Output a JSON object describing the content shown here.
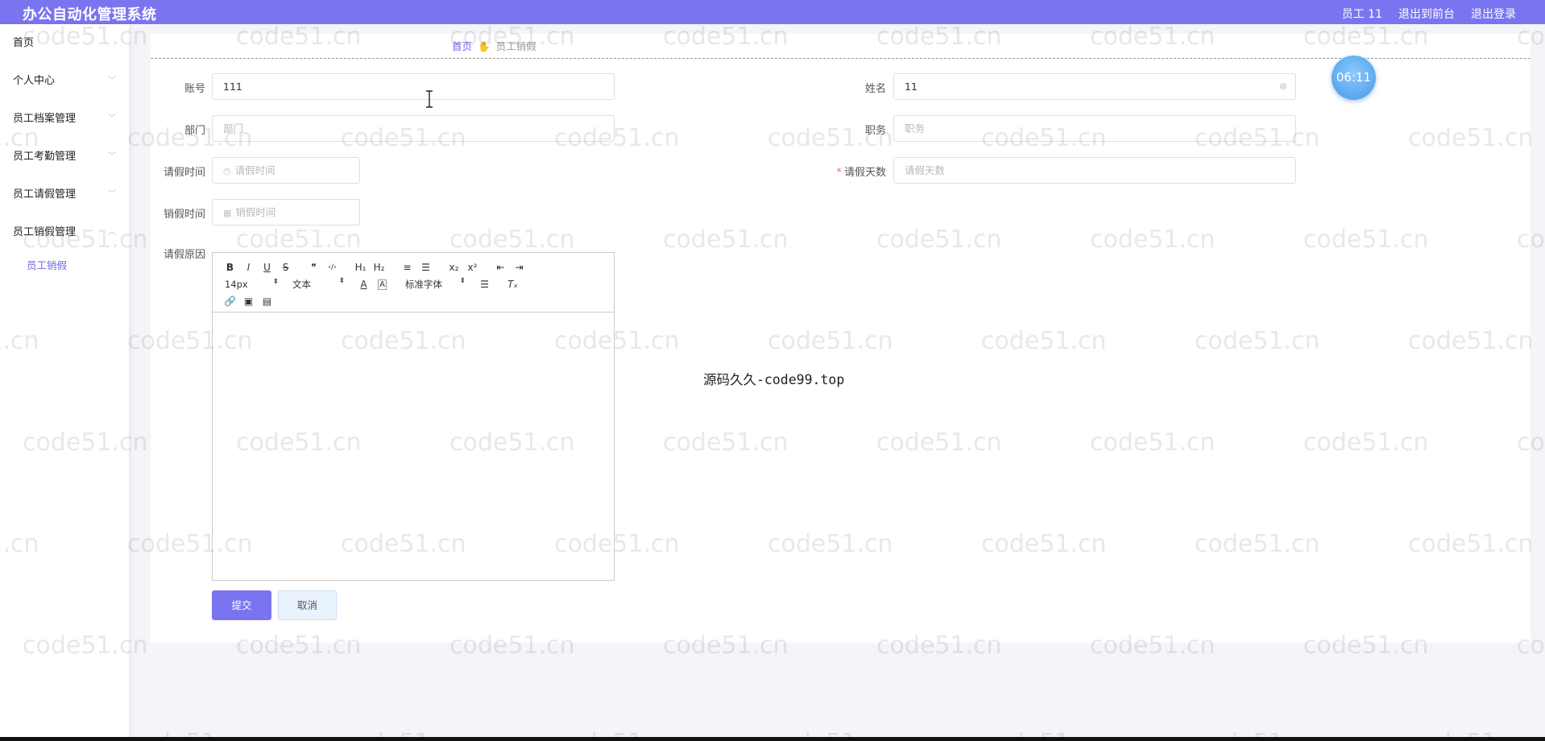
{
  "app": {
    "title": "办公自动化管理系统"
  },
  "header": {
    "user_label": "员工 11",
    "front_link": "退出到前台",
    "logout_link": "退出登录"
  },
  "sidebar": {
    "items": [
      {
        "label": "首页",
        "has_chevron": false
      },
      {
        "label": "个人中心",
        "has_chevron": true
      },
      {
        "label": "员工档案管理",
        "has_chevron": true
      },
      {
        "label": "员工考勤管理",
        "has_chevron": true
      },
      {
        "label": "员工请假管理",
        "has_chevron": true
      },
      {
        "label": "员工销假管理",
        "has_chevron": true
      }
    ],
    "active_subitem": "员工销假"
  },
  "breadcrumb": {
    "home": "首页",
    "current": "员工销假"
  },
  "form": {
    "account": {
      "label": "账号",
      "value": "111"
    },
    "name": {
      "label": "姓名",
      "value": "11"
    },
    "department": {
      "label": "部门",
      "placeholder": "部门"
    },
    "position": {
      "label": "职务",
      "placeholder": "职务"
    },
    "leave_time": {
      "label": "请假时间",
      "placeholder": "请假时间"
    },
    "leave_days": {
      "label": "请假天数",
      "placeholder": "请假天数",
      "required": true
    },
    "cancel_time": {
      "label": "销假时间",
      "placeholder": "销假时间"
    },
    "reason": {
      "label": "请假原因"
    }
  },
  "editor": {
    "toolbar_row1": [
      "B",
      "I",
      "U",
      "S",
      "❞",
      "‹/›",
      "H₁",
      "H₂",
      "≡",
      "☰",
      "x₂",
      "x²",
      "⇤",
      "⇥"
    ],
    "font_size": "14px",
    "block_type": "文本",
    "font_family": "标准字体",
    "content": ""
  },
  "buttons": {
    "submit": "提交",
    "cancel": "取消"
  },
  "timer": "06:11",
  "center_note": "源码久久-code99.top",
  "watermark": "code51.cn",
  "colors": {
    "primary": "#7b74f0",
    "timer": "#5aa7ef",
    "required": "#f56c6c"
  }
}
